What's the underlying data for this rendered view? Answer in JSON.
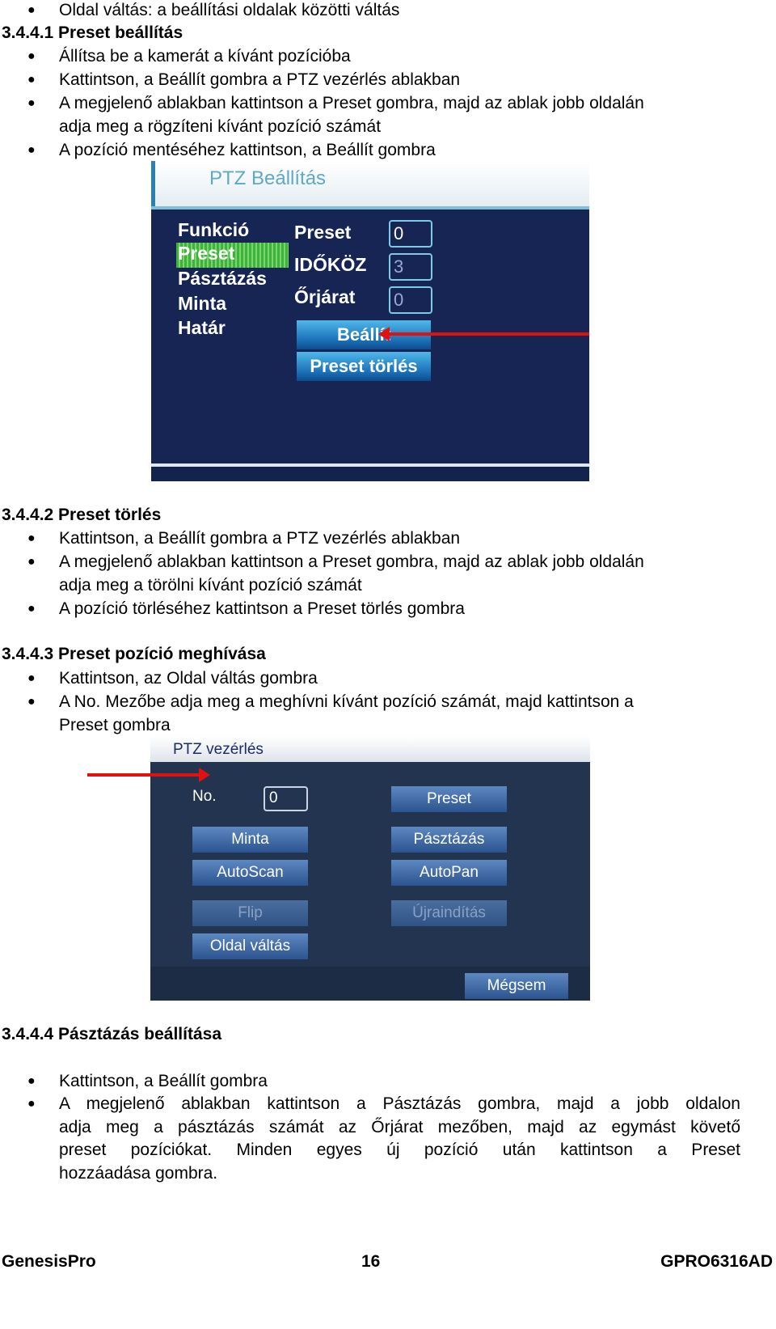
{
  "intro_bullet": "Oldal váltás: a beállítási oldalak közötti váltás",
  "s1": {
    "heading": "3.4.4.1 Preset beállítás",
    "bullets": [
      "Állítsa be a kamerát a kívánt pozícióba",
      "Kattintson, a Beállít gombra a PTZ vezérlés ablakban",
      "A megjelenő ablakban kattintson a Preset gombra, majd az ablak jobb oldalán",
      "adja meg a rögzíteni kívánt pozíció számát",
      "A pozíció mentéséhez kattintson, a Beállít gombra"
    ]
  },
  "shot1": {
    "title": "PTZ Beállítás",
    "menu": [
      "Funkció",
      "Preset",
      "Pásztázás",
      "Minta",
      "Határ"
    ],
    "fields": [
      {
        "label": "Preset",
        "value": "0"
      },
      {
        "label": "IDŐKÖZ",
        "value": "3"
      },
      {
        "label": "Őrjárat",
        "value": "0"
      }
    ],
    "set_button": "Beállít",
    "delete_button": "Preset törlés",
    "highlight_color": "#3db33d",
    "arrow_color": "#e31010"
  },
  "s2": {
    "heading": "3.4.4.2 Preset törlés",
    "bullets": [
      "Kattintson, a Beállít gombra a PTZ vezérlés ablakban",
      "A megjelenő ablakban kattintson a Preset gombra, majd az ablak jobb oldalán",
      "adja meg a törölni kívánt pozíció számát",
      "A pozíció törléséhez kattintson a Preset törlés gombra"
    ]
  },
  "s3": {
    "heading": "3.4.4.3 Preset pozíció meghívása",
    "bullets": [
      "Kattintson, az Oldal váltás gombra",
      "A No. Mezőbe adja meg a meghívni kívánt pozíció számát, majd kattintson a",
      "Preset gombra"
    ]
  },
  "shot2": {
    "title": "PTZ vezérlés",
    "no_label": "No.",
    "no_value": "0",
    "buttons": {
      "preset": "Preset",
      "minta": "Minta",
      "pasztazas": "Pásztázás",
      "autoscan": "AutoScan",
      "autopan": "AutoPan",
      "flip": "Flip",
      "ujrainditas": "Újraindítás",
      "oldal_valtas": "Oldal váltás",
      "megsem": "Mégsem"
    }
  },
  "s4": {
    "heading": "3.4.4.4 Pásztázás beállítása",
    "bullets": [
      "Kattintson, a Beállít gombra",
      "A megjelenő ablakban kattintson a Pásztázás gombra, majd a jobb oldalon",
      "adja meg a pásztázás számát az Őrjárat mezőben, majd az egymást követő",
      "preset pozíciókat. Minden egyes új pozíció után kattintson a Preset",
      "hozzáadása gombra."
    ]
  },
  "footer": {
    "left": "GenesisPro",
    "page": "16",
    "right": "GPRO6316AD"
  }
}
